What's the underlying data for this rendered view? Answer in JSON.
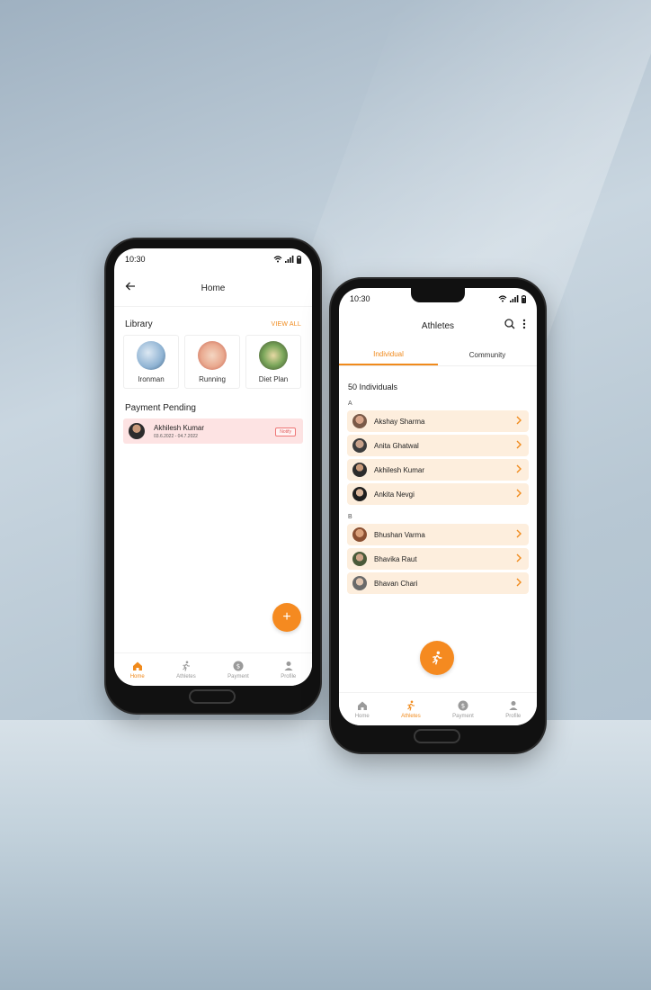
{
  "time": "10:30",
  "colors": {
    "accent": "#f08a1c",
    "pending_bg": "#fde3e3",
    "row_bg": "#fdeedd"
  },
  "home": {
    "title": "Home",
    "library": {
      "title": "Library",
      "view_all": "VIEW ALL",
      "items": [
        {
          "label": "Ironman"
        },
        {
          "label": "Running"
        },
        {
          "label": "Diet Plan"
        }
      ]
    },
    "payment": {
      "title": "Payment Pending",
      "name": "Akhilesh Kumar",
      "dates": "03.6.2022 - 04.7.2022",
      "notify": "Notify"
    },
    "fab": "+"
  },
  "nav": {
    "home": "Home",
    "athletes": "Athletes",
    "payment": "Payment",
    "profile": "Profile"
  },
  "athletes": {
    "title": "Athletes",
    "tabs": {
      "individual": "Individual",
      "community": "Community"
    },
    "count": "50 Individuals",
    "groups": [
      {
        "letter": "A",
        "names": [
          "Akshay Sharma",
          "Anita Ghatwal",
          "Akhilesh Kumar",
          "Ankita Nevgi"
        ]
      },
      {
        "letter": "B",
        "names": [
          "Bhushan Varma",
          "Bhavika Raut",
          "Bhavan Chari"
        ]
      }
    ]
  }
}
